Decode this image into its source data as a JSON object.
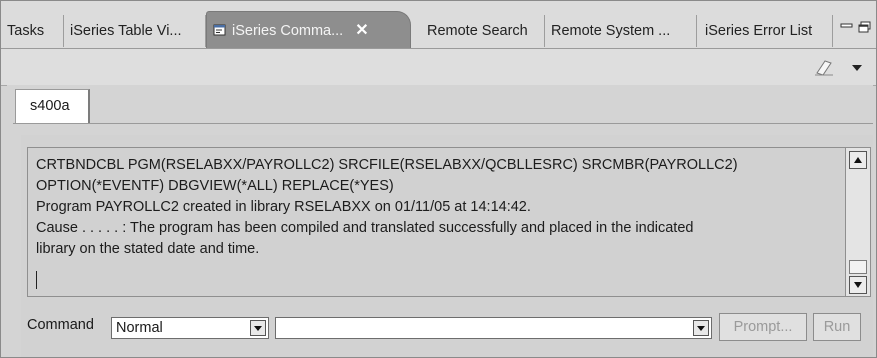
{
  "tabs": [
    {
      "label": "Tasks"
    },
    {
      "label": "iSeries Table Vi..."
    },
    {
      "label": "iSeries Comma..."
    },
    {
      "label": "Remote Search"
    },
    {
      "label": "Remote System ..."
    },
    {
      "label": "iSeries Error List"
    }
  ],
  "active_tab_index": 2,
  "session_tab": {
    "label": "s400a"
  },
  "output": {
    "lines": [
      "CRTBNDCBL PGM(RSELABXX/PAYROLLC2) SRCFILE(RSELABXX/QCBLLESRC) SRCMBR(PAYROLLC2)",
      "OPTION(*EVENTF) DBGVIEW(*ALL) REPLACE(*YES)",
      "Program PAYROLLC2 created in library RSELABXX on 01/11/05 at 14:14:42.",
      "Cause . . . . . :   The program has been compiled and translated successfully and placed in the indicated",
      "library on the stated date and time."
    ]
  },
  "command_bar": {
    "label": "Command",
    "mode_value": "Normal",
    "command_value": "",
    "prompt_label": "Prompt...",
    "run_label": "Run"
  },
  "icons": {
    "active_tab": "command-view-icon",
    "clear": "eraser-icon",
    "view_menu": "triangle-down-icon",
    "minimize": "minimize-icon",
    "maximize": "maximize-icon"
  }
}
